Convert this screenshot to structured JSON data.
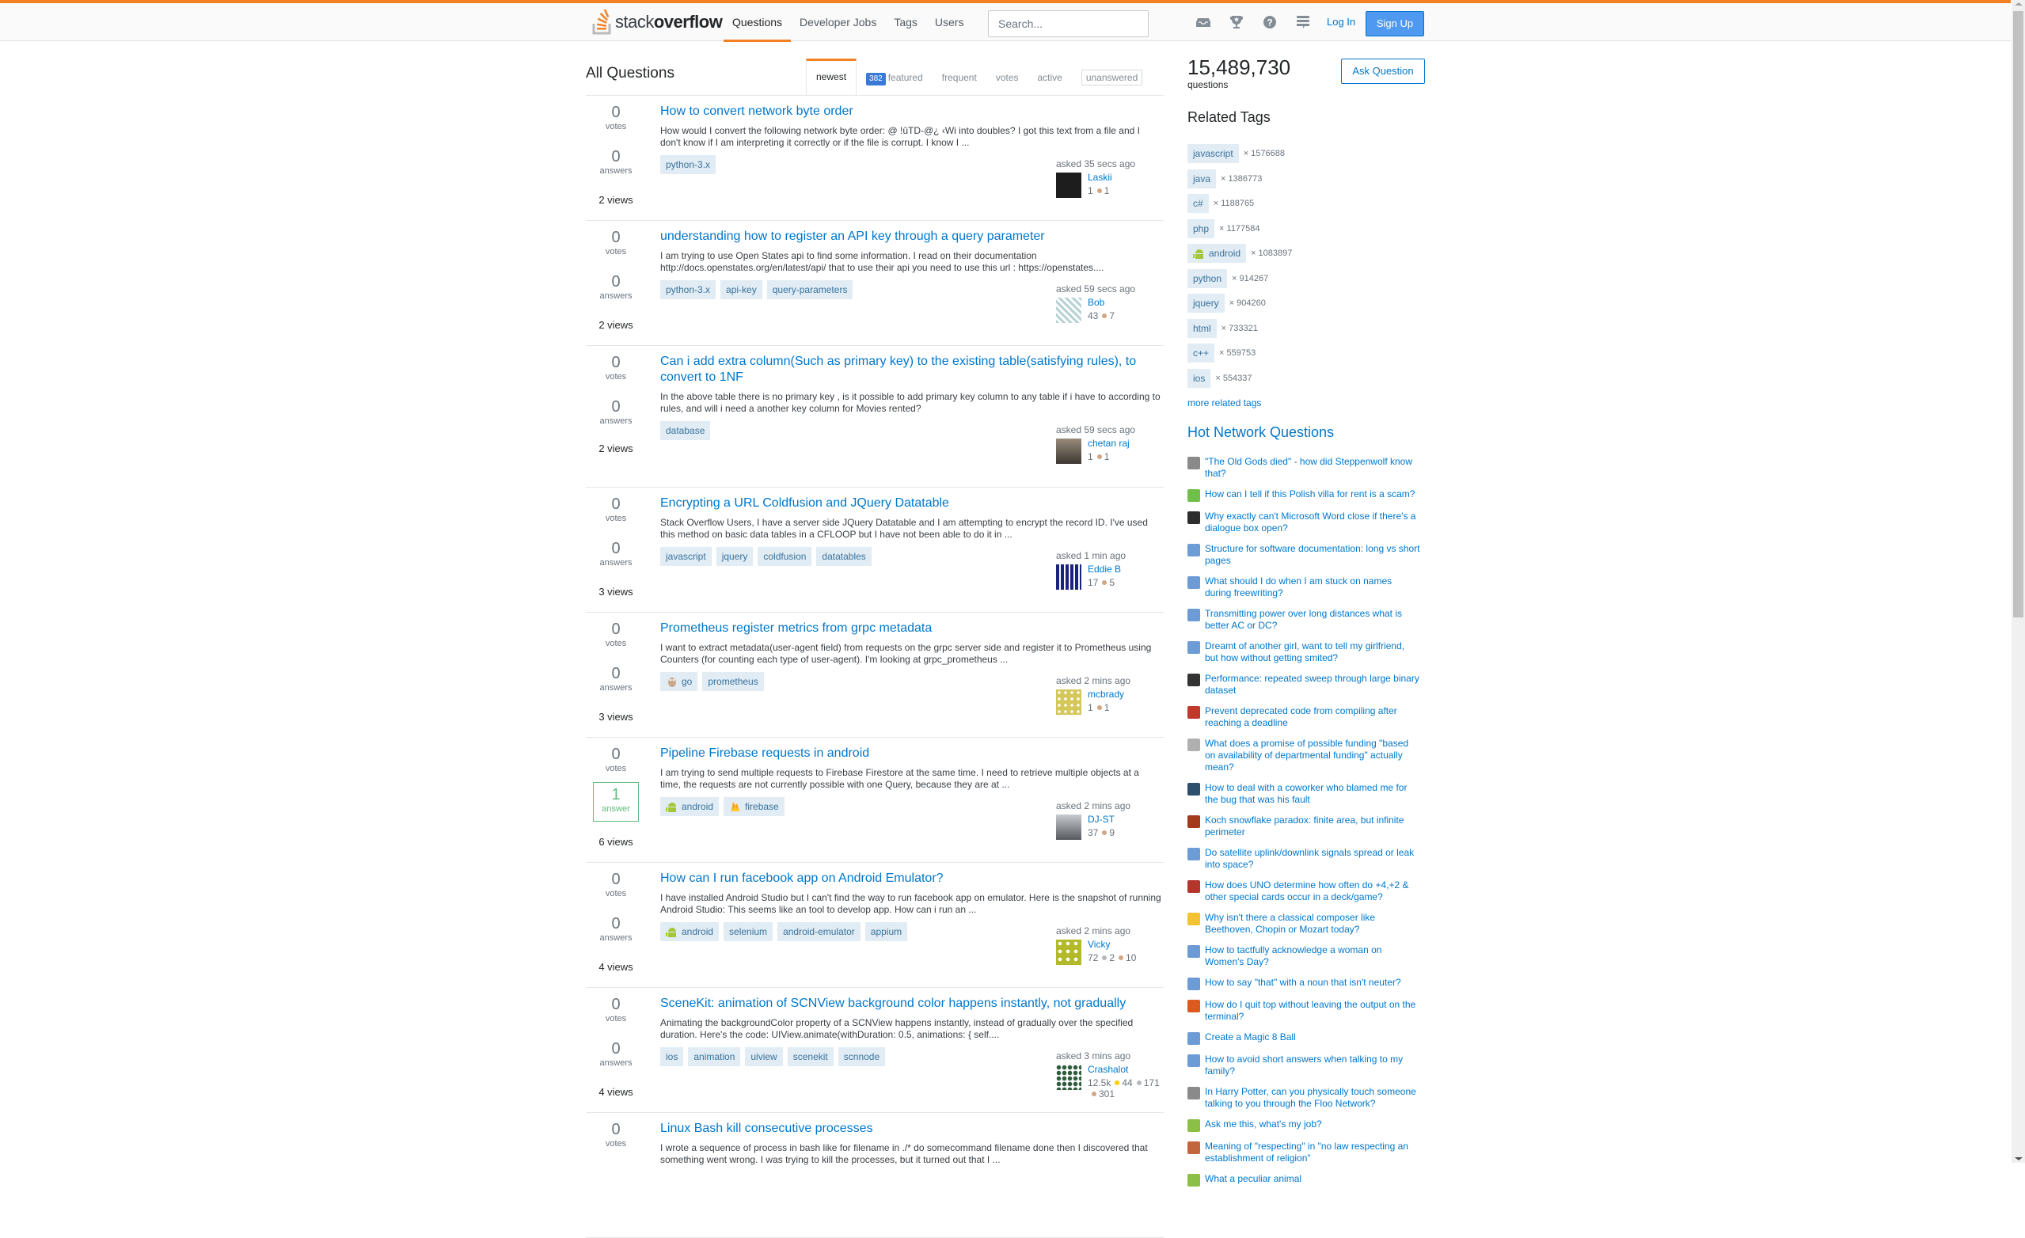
{
  "header": {
    "logo_text_light": "stack",
    "logo_text_bold": "overflow",
    "nav": [
      {
        "label": "Questions",
        "active": true
      },
      {
        "label": "Developer Jobs",
        "active": false
      },
      {
        "label": "Tags",
        "active": false
      },
      {
        "label": "Users",
        "active": false
      }
    ],
    "search_placeholder": "Search...",
    "icons": [
      "inbox-icon",
      "achievements-trophy-icon",
      "help-icon",
      "site-switcher-icon"
    ],
    "login_label": "Log In",
    "signup_label": "Sign Up"
  },
  "main": {
    "title": "All Questions",
    "tabs": [
      {
        "label": "newest",
        "active": true
      },
      {
        "label": "featured",
        "badge": "382"
      },
      {
        "label": "frequent"
      },
      {
        "label": "votes"
      },
      {
        "label": "active"
      },
      {
        "label": "unanswered",
        "boxed": true
      }
    ],
    "questions": [
      {
        "votes": "0",
        "votes_label": "votes",
        "answers": "0",
        "answers_label": "answers",
        "views": "2 views",
        "title": "How to convert network byte order",
        "excerpt": "How would I convert the following network byte order: @ !ûTD-@¿ ‹Wi into doubles? I got this text from a file and I don't know if I am interpreting it correctly or if the file is corrupt. I know I ...",
        "tags": [
          "python-3.x"
        ],
        "asked": "asked 35 secs ago",
        "user": "Laskii",
        "rep": "1",
        "badges": [
          {
            "type": "bronze",
            "count": "1"
          }
        ]
      },
      {
        "votes": "0",
        "votes_label": "votes",
        "answers": "0",
        "answers_label": "answers",
        "views": "2 views",
        "title": "understanding how to register an API key through a query parameter",
        "excerpt": "I am trying to use Open States api to find some information. I read on their documentation http://docs.openstates.org/en/latest/api/ that to use their api you need to use this url : https://openstates....",
        "tags": [
          "python-3.x",
          "api-key",
          "query-parameters"
        ],
        "asked": "asked 59 secs ago",
        "user": "Bob",
        "rep": "43",
        "badges": [
          {
            "type": "bronze",
            "count": "7"
          }
        ]
      },
      {
        "votes": "0",
        "votes_label": "votes",
        "answers": "0",
        "answers_label": "answers",
        "views": "2 views",
        "title": "Can i add extra column(Such as primary key) to the existing table(satisfying rules), to convert to 1NF",
        "excerpt": "In the above table there is no primary key , is it possible to add primary key column to any table if i have to according to rules, and will i need a another key column for Movies rented?",
        "tags": [
          "database"
        ],
        "asked": "asked 59 secs ago",
        "user": "chetan raj",
        "rep": "1",
        "badges": [
          {
            "type": "bronze",
            "count": "1"
          }
        ]
      },
      {
        "votes": "0",
        "votes_label": "votes",
        "answers": "0",
        "answers_label": "answers",
        "views": "3 views",
        "title": "Encrypting a URL Coldfusion and JQuery Datatable",
        "excerpt": "Stack Overflow Users, I have a server side JQuery Datatable and I am attempting to encrypt the record ID. I've used this method on basic data tables in a CFLOOP but I have not been able to do it in ...",
        "tags": [
          "javascript",
          "jquery",
          "coldfusion",
          "datatables"
        ],
        "asked": "asked 1 min ago",
        "user": "Eddie B",
        "rep": "17",
        "badges": [
          {
            "type": "bronze",
            "count": "5"
          }
        ]
      },
      {
        "votes": "0",
        "votes_label": "votes",
        "answers": "0",
        "answers_label": "answers",
        "views": "3 views",
        "title": "Prometheus register metrics from grpc metadata",
        "excerpt": "I want to extract metadata(user-agent field) from requests on the grpc server side and register it to Prometheus using Counters (for counting each type of user-agent). I'm looking at grpc_prometheus ...",
        "tags": [
          "go",
          "prometheus"
        ],
        "asked": "asked 2 mins ago",
        "user": "mcbrady",
        "rep": "1",
        "badges": [
          {
            "type": "bronze",
            "count": "1"
          }
        ]
      },
      {
        "votes": "0",
        "votes_label": "votes",
        "answers": "1",
        "answers_label": "answer",
        "answered": true,
        "views": "6 views",
        "title": "Pipeline Firebase requests in android",
        "excerpt": "I am trying to send multiple requests to Firebase Firestore at the same time. I need to retrieve multiple objects at a time, the requests are not currently possible with one Query, because they are at ...",
        "tags": [
          "android",
          "firebase"
        ],
        "asked": "asked 2 mins ago",
        "user": "DJ-ST",
        "rep": "37",
        "badges": [
          {
            "type": "bronze",
            "count": "9"
          }
        ]
      },
      {
        "votes": "0",
        "votes_label": "votes",
        "answers": "0",
        "answers_label": "answers",
        "views": "4 views",
        "title": "How can I run facebook app on Android Emulator?",
        "excerpt": "I have installed Android Studio but I can't find the way to run facebook app on emulator. Here is the snapshot of running Android Studio: This seems like an tool to develop app. How can i run an ...",
        "tags": [
          "android",
          "selenium",
          "android-emulator",
          "appium"
        ],
        "asked": "asked 2 mins ago",
        "user": "Vicky",
        "rep": "72",
        "badges": [
          {
            "type": "silver",
            "count": "2"
          },
          {
            "type": "bronze",
            "count": "10"
          }
        ]
      },
      {
        "votes": "0",
        "votes_label": "votes",
        "answers": "0",
        "answers_label": "answers",
        "views": "4 views",
        "title": "SceneKit: animation of SCNView background color happens instantly, not gradually",
        "excerpt": "Animating the backgroundColor property of a SCNView happens instantly, instead of gradually over the specified duration. Here's the code: UIView.animate(withDuration: 0.5, animations: { self....",
        "tags": [
          "ios",
          "animation",
          "uiview",
          "scenekit",
          "scnnode"
        ],
        "asked": "asked 3 mins ago",
        "user": "Crashalot",
        "rep": "12.5k",
        "badges": [
          {
            "type": "gold",
            "count": "44"
          },
          {
            "type": "silver",
            "count": "171"
          },
          {
            "type": "bronze",
            "count": "301"
          }
        ]
      },
      {
        "votes": "0",
        "votes_label": "votes",
        "answers": "",
        "answers_label": "",
        "views": "",
        "title": "Linux Bash kill consecutive processes",
        "excerpt": "I wrote a sequence of process in bash like for filename in ./* do somecommand filename done then I discovered that something went wrong. I was trying to kill the processes, but it turned out that I ...",
        "tags": [],
        "asked": "",
        "user": "",
        "rep": "",
        "badges": []
      }
    ]
  },
  "sidebar": {
    "question_count": "15,489,730",
    "question_count_label": "questions",
    "ask_label": "Ask Question",
    "related_tags_title": "Related Tags",
    "related_tags": [
      {
        "name": "javascript",
        "count": "× 1576688"
      },
      {
        "name": "java",
        "count": "× 1386773"
      },
      {
        "name": "c#",
        "count": "× 1188765"
      },
      {
        "name": "php",
        "count": "× 1177584"
      },
      {
        "name": "android",
        "count": "× 1083897"
      },
      {
        "name": "python",
        "count": "× 914267"
      },
      {
        "name": "jquery",
        "count": "× 904260"
      },
      {
        "name": "html",
        "count": "× 733321"
      },
      {
        "name": "c++",
        "count": "× 559753"
      },
      {
        "name": "ios",
        "count": "× 554337"
      }
    ],
    "more_tags_label": "more related tags",
    "hot_title": "Hot Network Questions",
    "hot_questions": [
      {
        "title": "\"The Old Gods died\" - how did Steppenwolf know that?",
        "site_icon": "scifi-icon",
        "color": "#8a8a8a"
      },
      {
        "title": "How can I tell if this Polish villa for rent is a scam?",
        "site_icon": "travel-icon",
        "color": "#6fbf4a"
      },
      {
        "title": "Why exactly can't Microsoft Word close if there's a dialogue box open?",
        "site_icon": "superuser-icon",
        "color": "#2d2d2d"
      },
      {
        "title": "Structure for software documentation: long vs short pages",
        "site_icon": "writing-icon",
        "color": "#6c9bd6"
      },
      {
        "title": "What should I do when I am stuck on names during freewriting?",
        "site_icon": "writing-icon",
        "color": "#6c9bd6"
      },
      {
        "title": "Transmitting power over long distances what is better AC or DC?",
        "site_icon": "engineering-icon",
        "color": "#6c9bd6"
      },
      {
        "title": "Dreamt of another girl, want to tell my girlfriend, but how without getting smited?",
        "site_icon": "interpersonal-icon",
        "color": "#6c9bd6"
      },
      {
        "title": "Performance: repeated sweep through large binary dataset",
        "site_icon": "codereview-icon",
        "color": "#333333"
      },
      {
        "title": "Prevent deprecated code from compiling after reaching a deadline",
        "site_icon": "softwareengineering-icon",
        "color": "#c0392b"
      },
      {
        "title": "What does a promise of possible funding \"based on availability of departmental funding\" actually mean?",
        "site_icon": "academia-icon",
        "color": "#b0b0b0"
      },
      {
        "title": "How to deal with a coworker who blamed me for the bug that was his fault",
        "site_icon": "workplace-icon",
        "color": "#2c4f6e"
      },
      {
        "title": "Koch snowflake paradox: finite area, but infinite perimeter",
        "site_icon": "math-icon",
        "color": "#a33a1c"
      },
      {
        "title": "Do satellite uplink/downlink signals spread or leak into space?",
        "site_icon": "space-icon",
        "color": "#6c9bd6"
      },
      {
        "title": "How does UNO determine how often do +4,+2 & other special cards occur in a deck/game?",
        "site_icon": "boardgames-icon",
        "color": "#b5352c"
      },
      {
        "title": "Why isn't there a classical composer like Beethoven, Chopin or Mozart today?",
        "site_icon": "music-icon",
        "color": "#f2c230"
      },
      {
        "title": "How to tactfully acknowledge a woman on Women's Day?",
        "site_icon": "interpersonal-icon",
        "color": "#6c9bd6"
      },
      {
        "title": "How to say \"that\" with a noun that isn't neuter?",
        "site_icon": "german-icon",
        "color": "#6c9bd6"
      },
      {
        "title": "How do I quit top without leaving the output on the terminal?",
        "site_icon": "askubuntu-icon",
        "color": "#dd5a1e"
      },
      {
        "title": "Create a Magic 8 Ball",
        "site_icon": "codegolf-icon",
        "color": "#6c9bd6"
      },
      {
        "title": "How to avoid short answers when talking to my family?",
        "site_icon": "interpersonal-icon",
        "color": "#6c9bd6"
      },
      {
        "title": "In Harry Potter, can you physically touch someone talking to you through the Floo Network?",
        "site_icon": "scifi-icon",
        "color": "#8a8a8a"
      },
      {
        "title": "Ask me this, what's my job?",
        "site_icon": "puzzling-icon",
        "color": "#8bbf45"
      },
      {
        "title": "Meaning of \"respecting\" in \"no law respecting an establishment of religion\"",
        "site_icon": "english-icon",
        "color": "#c4663d"
      },
      {
        "title": "What a peculiar animal",
        "site_icon": "puzzling-icon",
        "color": "#8bbf45"
      }
    ]
  },
  "colors": {
    "accent_orange": "#f48024",
    "link_blue": "#0077cc",
    "tag_bg": "#e1ecf4",
    "tag_text": "#39739d",
    "answered_green": "#5eba7d",
    "signup_blue": "#4f9af0"
  }
}
